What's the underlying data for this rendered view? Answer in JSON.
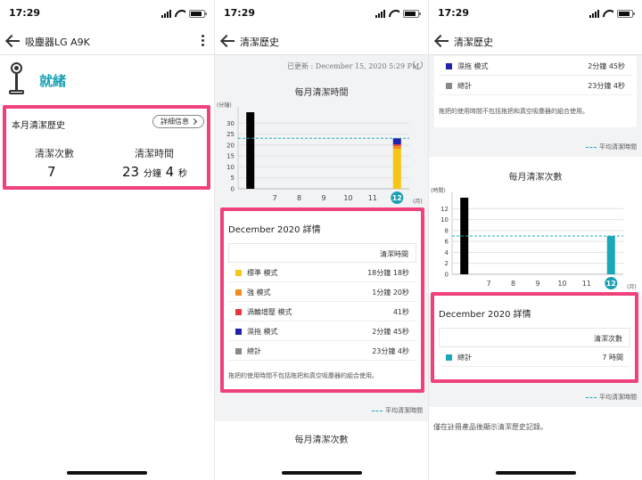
{
  "status": {
    "time": "17:29"
  },
  "colors": {
    "accent": "#1aa0b5",
    "highlight": "#f0427a",
    "standard": "#f5c518",
    "strong": "#f08c1e",
    "turbo": "#e53935",
    "mop": "#2222aa",
    "total": "#888888",
    "bar_history": "#000000",
    "avg_line": "#1aa8b8"
  },
  "screen1": {
    "title": "吸塵器LG A9K",
    "status_label": "就緒",
    "monthly": {
      "title": "本月清潔歷史",
      "detail_button": "詳細信息",
      "count_label": "清潔次數",
      "count_value": "7",
      "time_label": "清潔時間",
      "time_min": "23",
      "time_min_unit": "分鐘",
      "time_sec": "4",
      "time_sec_unit": "秒"
    }
  },
  "screen2": {
    "title": "清潔歷史",
    "updated": "已更新 : December 15, 2020 5:29 PM",
    "chart_title": "每月清潔時間",
    "avg_legend": "平均清潔時間",
    "next_chart_title": "每月清潔次數",
    "detail": {
      "title": "December 2020 詳情",
      "col_header": "清潔時間",
      "rows": [
        {
          "name": "標準 模式",
          "value": "18分鐘 18秒"
        },
        {
          "name": "強 模式",
          "value": "1分鐘 20秒"
        },
        {
          "name": "渦輪增壓 模式",
          "value": "41秒"
        },
        {
          "name": "濕拖 模式",
          "value": "2分鐘 45秒"
        },
        {
          "name": "總計",
          "value": "23分鐘 4秒"
        }
      ],
      "note": "拖把的使用時間不包括拖把和真空吸塵器的組合使用。"
    }
  },
  "screen3": {
    "title": "清潔歷史",
    "rows_top": [
      {
        "name": "濕拖 模式",
        "value": "2分鐘 45秒"
      },
      {
        "name": "總計",
        "value": "23分鐘 4秒"
      }
    ],
    "note": "拖把的使用時間不包括拖把和真空吸塵器的組合使用。",
    "avg_legend_top": "平均清潔時間",
    "chart_title": "每月清潔次數",
    "avg_legend": "平均清潔時間",
    "detail": {
      "title": "December 2020 詳情",
      "col_header": "清潔次數",
      "rows": [
        {
          "name": "總計",
          "value": "7 時間"
        }
      ]
    },
    "footer_note": "僅在註冊產品後顯示清潔歷史記錄。"
  },
  "chart_data": [
    {
      "type": "bar",
      "title": "每月清潔時間",
      "ylabel": "(分鐘)",
      "xlabel": "(月)",
      "categories": [
        "7",
        "8",
        "9",
        "10",
        "11",
        "12"
      ],
      "yticks": [
        0,
        5,
        10,
        15,
        20,
        25,
        30
      ],
      "ylim": [
        0,
        35
      ],
      "series": [
        {
          "name": "標準 模式",
          "values": [
            0,
            0,
            0,
            0,
            0,
            18.3
          ]
        },
        {
          "name": "強 模式",
          "values": [
            0,
            0,
            0,
            0,
            0,
            1.3
          ]
        },
        {
          "name": "渦輪增壓 模式",
          "values": [
            0,
            0,
            0,
            0,
            0,
            0.7
          ]
        },
        {
          "name": "濕拖 模式",
          "values": [
            0,
            0,
            0,
            0,
            0,
            2.8
          ]
        }
      ],
      "history_bar": 35,
      "average": 23.1,
      "selected": "12"
    },
    {
      "type": "bar",
      "title": "每月清潔次數",
      "ylabel": "(時間)",
      "xlabel": "(月)",
      "categories": [
        "7",
        "8",
        "9",
        "10",
        "11",
        "12"
      ],
      "yticks": [
        0,
        2,
        4,
        6,
        8,
        10,
        12
      ],
      "ylim": [
        0,
        14
      ],
      "values": [
        0,
        0,
        0,
        0,
        0,
        7
      ],
      "history_bar": 14,
      "average": 7,
      "selected": "12"
    }
  ]
}
